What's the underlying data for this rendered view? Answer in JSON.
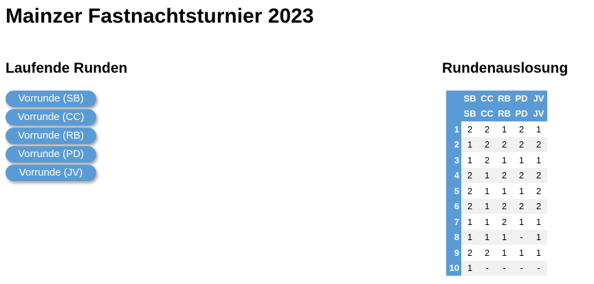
{
  "page": {
    "title": "Mainzer Fastnachtsturnier 2023"
  },
  "running_rounds": {
    "heading": "Laufende Runden",
    "buttons": [
      {
        "label": "Vorrunde (SB)"
      },
      {
        "label": "Vorrunde (CC)"
      },
      {
        "label": "Vorrunde (RB)"
      },
      {
        "label": "Vorrunde (PD)"
      },
      {
        "label": "Vorrunde (JV)"
      }
    ]
  },
  "draw": {
    "heading": "Rundenauslosung",
    "header_rows": [
      [
        "SB",
        "CC",
        "RB",
        "PD",
        "JV"
      ],
      [
        "SB",
        "CC",
        "RB",
        "PD",
        "JV"
      ]
    ],
    "rows": [
      {
        "round": "1",
        "cells": [
          "2",
          "2",
          "1",
          "2",
          "1"
        ]
      },
      {
        "round": "2",
        "cells": [
          "1",
          "2",
          "2",
          "2",
          "2"
        ]
      },
      {
        "round": "3",
        "cells": [
          "1",
          "2",
          "1",
          "1",
          "1"
        ]
      },
      {
        "round": "4",
        "cells": [
          "2",
          "1",
          "2",
          "2",
          "2"
        ]
      },
      {
        "round": "5",
        "cells": [
          "2",
          "1",
          "1",
          "1",
          "2"
        ]
      },
      {
        "round": "6",
        "cells": [
          "2",
          "1",
          "2",
          "2",
          "2"
        ]
      },
      {
        "round": "7",
        "cells": [
          "1",
          "1",
          "2",
          "1",
          "1"
        ]
      },
      {
        "round": "8",
        "cells": [
          "1",
          "1",
          "1",
          "-",
          "1"
        ]
      },
      {
        "round": "9",
        "cells": [
          "2",
          "2",
          "1",
          "1",
          "1"
        ]
      },
      {
        "round": "10",
        "cells": [
          "1",
          "-",
          "-",
          "-",
          "-"
        ]
      }
    ]
  },
  "colors": {
    "accent": "#5b9bd5",
    "row_stripe": "#f1f1f1"
  }
}
